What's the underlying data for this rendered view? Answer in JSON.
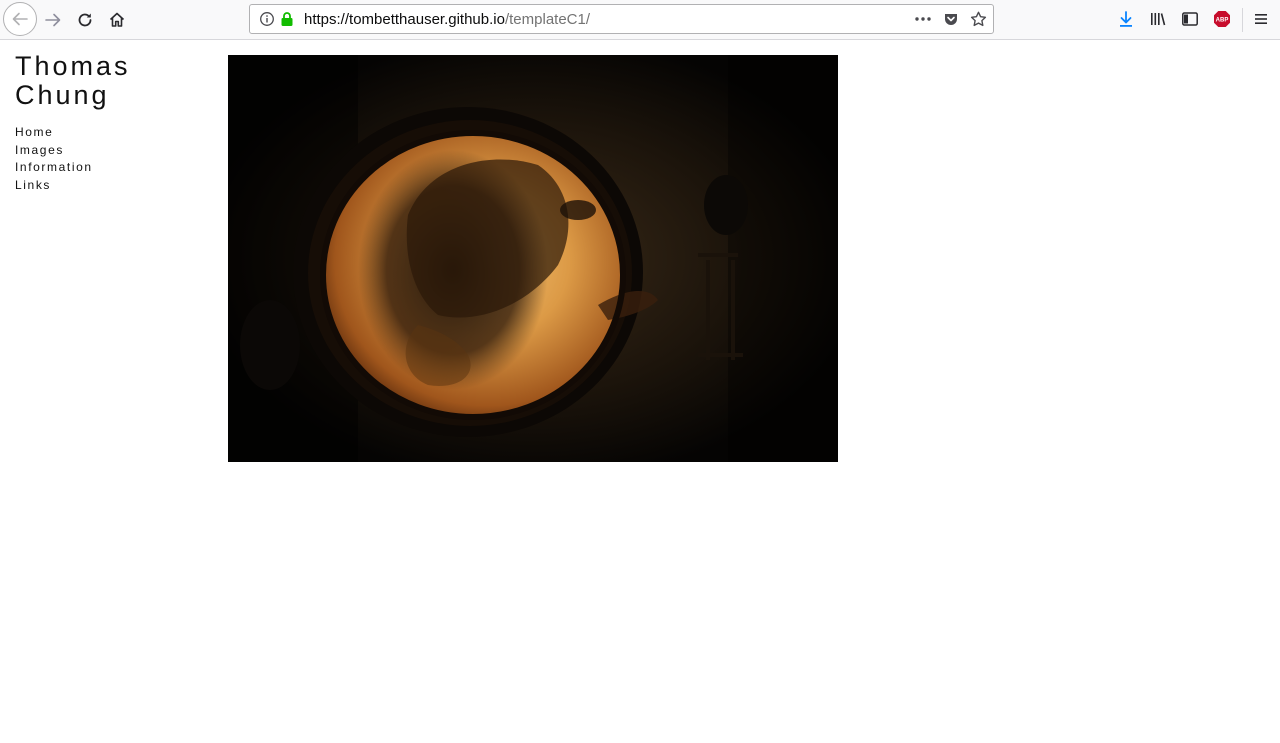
{
  "browser": {
    "url_host": "https://tombetthauser.github.io",
    "url_path": "/templateC1/"
  },
  "site": {
    "title_line1": "Thomas",
    "title_line2": "Chung"
  },
  "nav": {
    "items": [
      "Home",
      "Images",
      "Information",
      "Links"
    ]
  },
  "colors": {
    "page_bg": "#ffffff",
    "text": "#111111",
    "lock_green": "#12bc00",
    "download_blue": "#0a84ff",
    "abp_red": "#c70d2c"
  },
  "icons": [
    "back-arrow-icon",
    "forward-arrow-icon",
    "reload-icon",
    "home-icon",
    "info-icon",
    "lock-icon",
    "more-dots-icon",
    "pocket-icon",
    "bookmark-star-icon",
    "download-icon",
    "library-icon",
    "sidebar-icon",
    "adblock-icon",
    "menu-icon"
  ]
}
